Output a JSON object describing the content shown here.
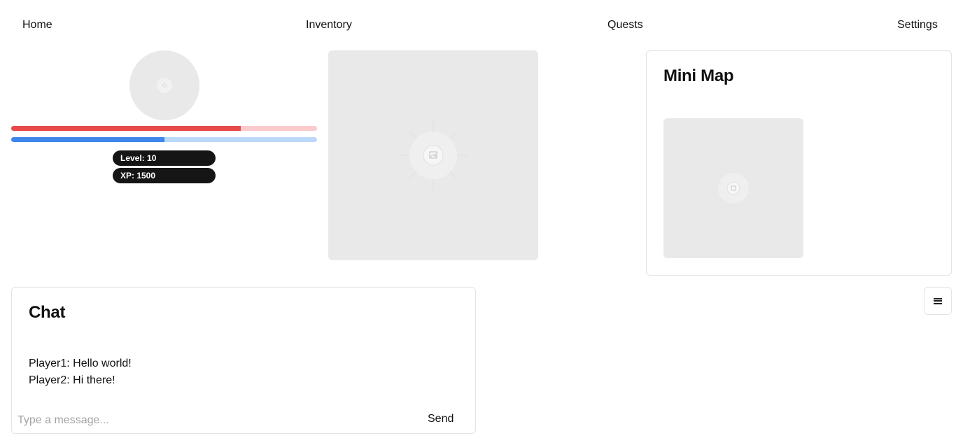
{
  "nav": {
    "home": "Home",
    "inventory": "Inventory",
    "quests": "Quests",
    "settings": "Settings"
  },
  "player": {
    "health_fraction": 0.75,
    "mana_fraction": 0.5,
    "level_text": "Level: 10",
    "xp_text": "XP: 1500"
  },
  "minimap": {
    "title": "Mini Map"
  },
  "chat": {
    "title": "Chat",
    "messages": [
      "Player1: Hello world!",
      "Player2: Hi there!"
    ],
    "input_placeholder": "Type a message...",
    "send_label": "Send"
  },
  "colors": {
    "health": "#e84a4a",
    "health_track": "#fcc9cc",
    "mana": "#3f86ea",
    "mana_track": "#bcd8fb",
    "pill_bg": "#151515",
    "placeholder_bg": "#e9e9e9"
  },
  "icons": {
    "menu": "hamburger-menu-icon",
    "image_placeholder": "image-icon"
  }
}
